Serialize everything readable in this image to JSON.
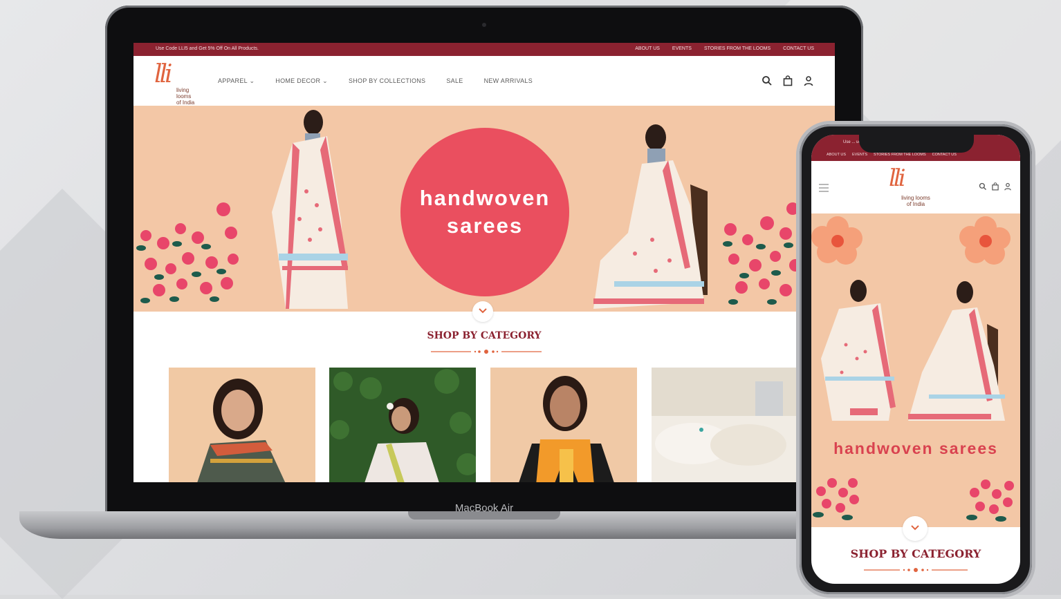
{
  "colors": {
    "brand_maroon": "#8b2230",
    "hero_peach": "#f3c7a6",
    "hero_circle": "#ea4f5f",
    "logo_orange": "#e0643f"
  },
  "laptop": {
    "device_label": "MacBook Air",
    "topbar": {
      "promo": "Use Code LLI5 and Get 5% Off On All Products.",
      "links": [
        "ABOUT US",
        "EVENTS",
        "STORIES FROM THE LOOMS",
        "CONTACT US"
      ]
    },
    "logo": {
      "mark": "lli",
      "sub_line1": "living looms",
      "sub_line2": "of India"
    },
    "nav": [
      {
        "label": "APPAREL",
        "has_dropdown": true
      },
      {
        "label": "HOME DECOR",
        "has_dropdown": true
      },
      {
        "label": "SHOP BY COLLECTIONS",
        "has_dropdown": false
      },
      {
        "label": "SALE",
        "has_dropdown": false
      },
      {
        "label": "NEW ARRIVALS",
        "has_dropdown": false
      }
    ],
    "header_icons": [
      "search-icon",
      "bag-icon",
      "user-icon"
    ],
    "hero": {
      "title": "handwoven\nsarees"
    },
    "category": {
      "title": "SHOP BY CATEGORY"
    }
  },
  "phone": {
    "topbar": {
      "promo": "Use ... ucts.",
      "links": [
        "ABOUT US",
        "EVENTS",
        "STORIES FROM THE LOOMS",
        "CONTACT US"
      ]
    },
    "logo": {
      "mark": "lli",
      "sub_line1": "living looms",
      "sub_line2": "of India"
    },
    "header_icons": [
      "search-icon",
      "bag-icon",
      "user-icon"
    ],
    "hero": {
      "title": "handwoven sarees"
    },
    "category": {
      "title": "SHOP BY CATEGORY"
    }
  }
}
